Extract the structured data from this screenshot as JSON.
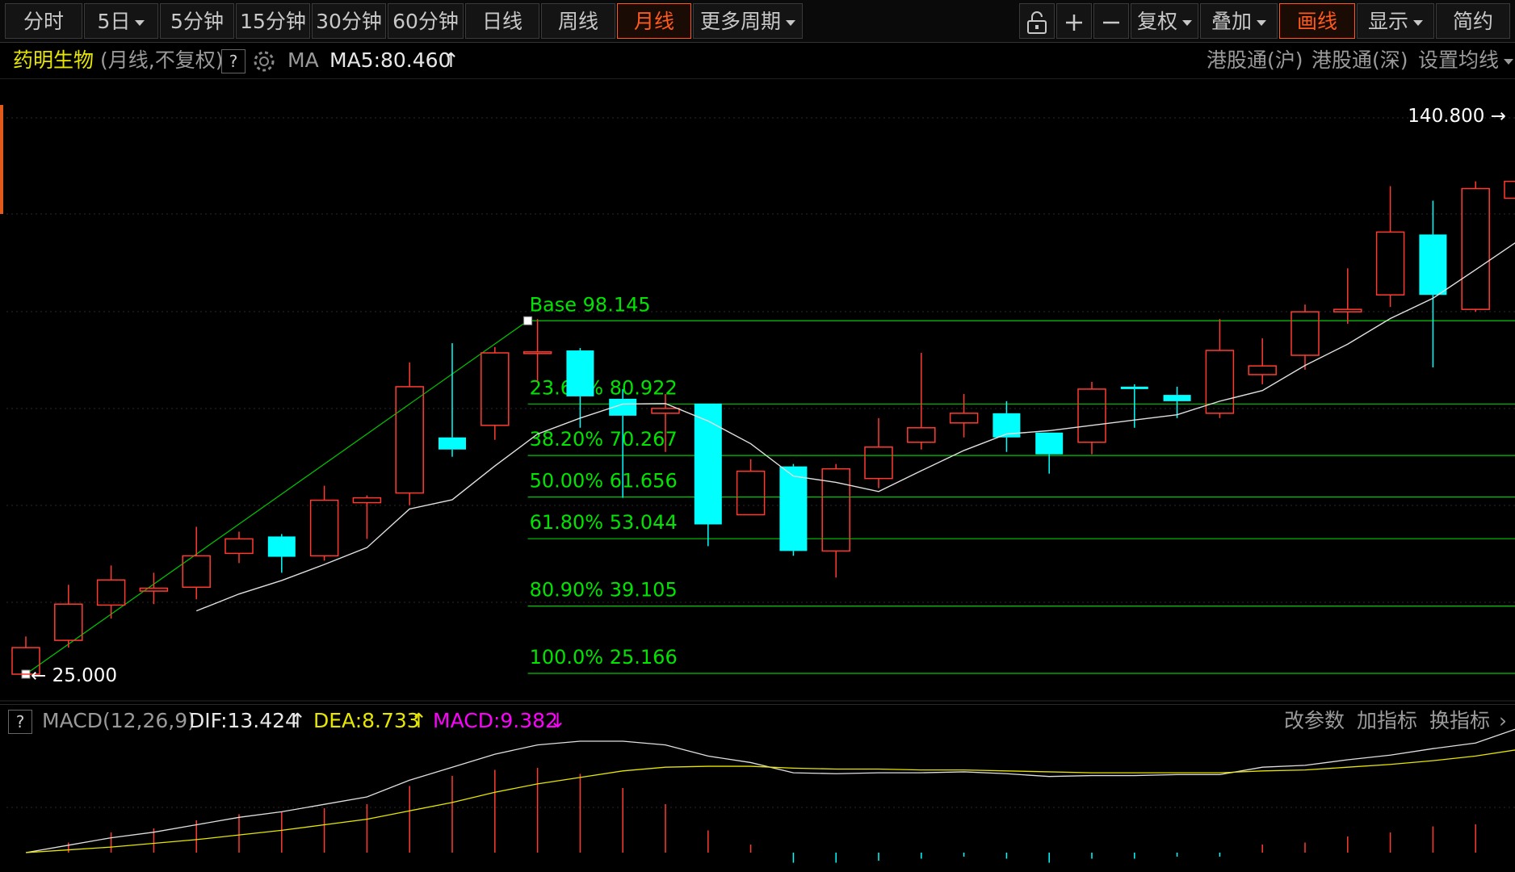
{
  "toolbar": {
    "periods": [
      "分时",
      "5日",
      "5分钟",
      "15分钟",
      "30分钟",
      "60分钟",
      "日线",
      "周线",
      "月线",
      "更多周期"
    ],
    "active_period": "月线",
    "tools": [
      "复权",
      "叠加",
      "画线",
      "显示",
      "简约"
    ],
    "active_tool": "画线"
  },
  "info": {
    "stock_name": "药明生物",
    "mode": "(月线,不复权)",
    "help": "?",
    "ma_label": "MA",
    "ma5": "MA5:80.460",
    "links": [
      "港股通(沪)",
      "港股通(深)",
      "设置均线"
    ]
  },
  "macd_bar": {
    "help": "?",
    "name": "MACD(12,26,9)",
    "dif": "DIF:13.424",
    "dea": "DEA:8.733",
    "macd": "MACD:9.382",
    "actions": [
      "改参数",
      "加指标",
      "换指标"
    ]
  },
  "colors": {
    "up": "#ff3b30",
    "down": "#00ffff",
    "fib": "#00c800",
    "fib_text": "#00e400",
    "ma": "#e0e0e0",
    "dea": "#e6e600",
    "macd_text": "#ff00ff",
    "accent": "#ff5a1e"
  },
  "chart_data": {
    "type": "candlestick",
    "y_range": [
      25.0,
      140.8
    ],
    "price_labels": {
      "high": "140.800",
      "low": "25.000"
    },
    "candles": [
      {
        "o": 25.0,
        "c": 30.5,
        "h": 32.8,
        "l": 25.0
      },
      {
        "o": 32.0,
        "c": 39.5,
        "h": 43.5,
        "l": 30.5
      },
      {
        "o": 39.3,
        "c": 44.5,
        "h": 47.5,
        "l": 36.5
      },
      {
        "o": 42.2,
        "c": 42.8,
        "h": 46.0,
        "l": 39.5
      },
      {
        "o": 43.0,
        "c": 49.5,
        "h": 55.5,
        "l": 40.5
      },
      {
        "o": 50.0,
        "c": 53.0,
        "h": 54.5,
        "l": 48.0
      },
      {
        "o": 53.5,
        "c": 49.3,
        "h": 54.0,
        "l": 46.0
      },
      {
        "o": 49.5,
        "c": 61.0,
        "h": 64.0,
        "l": 48.5
      },
      {
        "o": 60.5,
        "c": 61.5,
        "h": 62.0,
        "l": 53.0
      },
      {
        "o": 62.5,
        "c": 84.5,
        "h": 89.5,
        "l": 60.0
      },
      {
        "o": 74.0,
        "c": 71.5,
        "h": 93.5,
        "l": 70.0
      },
      {
        "o": 76.5,
        "c": 91.5,
        "h": 92.7,
        "l": 73.5
      },
      {
        "o": 91.5,
        "c": 91.7,
        "h": 98.5,
        "l": 85.5
      },
      {
        "o": 92.0,
        "c": 82.5,
        "h": 92.5,
        "l": 76.0
      },
      {
        "o": 82.0,
        "c": 78.5,
        "h": 84.0,
        "l": 61.5
      },
      {
        "o": 79.0,
        "c": 80.0,
        "h": 83.0,
        "l": 71.0
      },
      {
        "o": 81.0,
        "c": 56.0,
        "h": 81.0,
        "l": 51.5
      },
      {
        "o": 58.0,
        "c": 67.0,
        "h": 69.5,
        "l": 58.0
      },
      {
        "o": 68.0,
        "c": 50.5,
        "h": 68.5,
        "l": 49.5
      },
      {
        "o": 50.5,
        "c": 67.5,
        "h": 68.5,
        "l": 45.0
      },
      {
        "o": 65.5,
        "c": 72.0,
        "h": 78.0,
        "l": 63.5
      },
      {
        "o": 73.0,
        "c": 76.0,
        "h": 91.5,
        "l": 71.5
      },
      {
        "o": 77.0,
        "c": 79.0,
        "h": 83.0,
        "l": 74.0
      },
      {
        "o": 79.0,
        "c": 74.0,
        "h": 81.5,
        "l": 71.0
      },
      {
        "o": 75.0,
        "c": 70.5,
        "h": 75.0,
        "l": 66.5
      },
      {
        "o": 73.0,
        "c": 84.0,
        "h": 85.5,
        "l": 70.5
      },
      {
        "o": 84.5,
        "c": 84.0,
        "h": 85.0,
        "l": 76.0
      },
      {
        "o": 82.8,
        "c": 81.5,
        "h": 84.5,
        "l": 78.0
      },
      {
        "o": 79.0,
        "c": 92.0,
        "h": 98.5,
        "l": 78.0
      },
      {
        "o": 87.0,
        "c": 88.8,
        "h": 94.5,
        "l": 85.0
      },
      {
        "o": 91.0,
        "c": 100.0,
        "h": 101.5,
        "l": 88.0
      },
      {
        "o": 100.0,
        "c": 100.5,
        "h": 109.0,
        "l": 97.5
      },
      {
        "o": 103.5,
        "c": 116.5,
        "h": 126.0,
        "l": 101.0
      },
      {
        "o": 116.0,
        "c": 103.5,
        "h": 123.0,
        "l": 88.5
      },
      {
        "o": 100.5,
        "c": 125.5,
        "h": 127.0,
        "l": 100.0
      },
      {
        "o": 123.5,
        "c": 127.0,
        "h": 140.8,
        "l": 121.0
      }
    ],
    "ma5": [
      null,
      null,
      null,
      null,
      38.1,
      41.6,
      44.4,
      47.7,
      51.2,
      59.2,
      61.1,
      68.1,
      74.7,
      78.0,
      80.9,
      81.0,
      77.4,
      72.7,
      66.0,
      64.7,
      62.8,
      67.1,
      71.3,
      74.7,
      75.4,
      76.5,
      77.6,
      78.7,
      81.5,
      83.7,
      88.9,
      93.3,
      98.6,
      102.8,
      108.7,
      114.7
    ],
    "fibonacci": [
      {
        "label": "Base",
        "value": "98.145",
        "price": 98.145
      },
      {
        "label": "23.60%",
        "value": "80.922",
        "price": 80.922
      },
      {
        "label": "38.20%",
        "value": "70.267",
        "price": 70.267
      },
      {
        "label": "50.00%",
        "value": "61.656",
        "price": 61.656
      },
      {
        "label": "61.80%",
        "value": "53.044",
        "price": 53.044
      },
      {
        "label": "80.90%",
        "value": "39.105",
        "price": 39.105
      },
      {
        "label": "100.0%",
        "value": "25.166",
        "price": 25.166
      }
    ],
    "fib_anchor_index": 12,
    "macd": {
      "dif": [
        0,
        0.8,
        1.6,
        2.2,
        3.0,
        3.8,
        4.4,
        5.2,
        6.0,
        7.8,
        9.2,
        10.6,
        11.6,
        12.0,
        12.0,
        11.6,
        10.4,
        9.7,
        8.6,
        8.5,
        8.6,
        8.6,
        8.7,
        8.5,
        8.2,
        8.3,
        8.3,
        8.4,
        8.4,
        9.2,
        9.4,
        10.0,
        10.5,
        11.2,
        11.8,
        13.4
      ],
      "dea": [
        0,
        0.3,
        0.6,
        1.0,
        1.4,
        1.9,
        2.4,
        3.0,
        3.6,
        4.5,
        5.4,
        6.5,
        7.4,
        8.1,
        8.8,
        9.2,
        9.3,
        9.3,
        9.1,
        9.0,
        9.0,
        8.9,
        8.9,
        8.8,
        8.7,
        8.6,
        8.6,
        8.6,
        8.6,
        8.8,
        8.9,
        9.2,
        9.5,
        9.9,
        10.4,
        11.1
      ],
      "hist": [
        0,
        1.0,
        2.0,
        2.4,
        3.2,
        3.8,
        4.0,
        4.4,
        4.8,
        6.6,
        7.6,
        8.2,
        8.4,
        7.8,
        6.4,
        4.8,
        2.2,
        0.8,
        -1.0,
        -1.0,
        -0.8,
        -0.6,
        -0.4,
        -0.6,
        -1.0,
        -0.6,
        -0.6,
        -0.4,
        -0.4,
        0.8,
        1.0,
        1.6,
        2.0,
        2.6,
        2.8,
        4.6
      ]
    }
  }
}
